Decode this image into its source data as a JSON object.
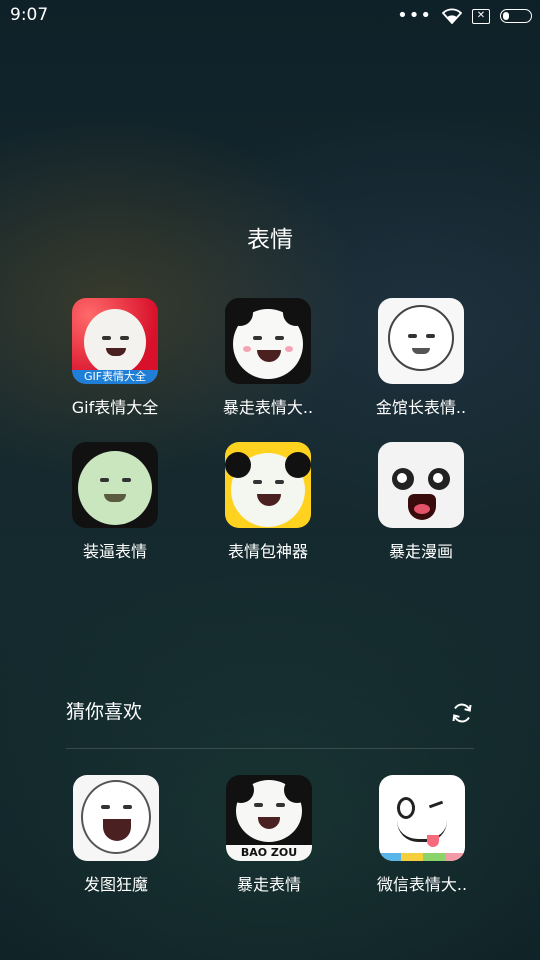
{
  "status_bar": {
    "time": "9:07",
    "icons": [
      "more-dots-icon",
      "wifi-icon",
      "no-sim-icon",
      "battery-icon"
    ]
  },
  "folder": {
    "title": "表情",
    "apps": [
      {
        "label": "Gif表情大全",
        "icon": "gif-meme-app-icon",
        "icon_text": "GIF表情大全"
      },
      {
        "label": "暴走表情大..",
        "icon": "baozou-meme-app-icon"
      },
      {
        "label": "金馆长表情..",
        "icon": "jinguanzhang-meme-app-icon"
      },
      {
        "label": "装逼表情",
        "icon": "zhuangbi-meme-app-icon"
      },
      {
        "label": "表情包神器",
        "icon": "meme-maker-app-icon"
      },
      {
        "label": "暴走漫画",
        "icon": "baozou-comic-app-icon"
      }
    ]
  },
  "recommend": {
    "title": "猜你喜欢",
    "apps": [
      {
        "label": "发图狂魔",
        "icon": "fatu-kuangmo-app-icon"
      },
      {
        "label": "暴走表情",
        "icon": "baozou-emoji-app-icon",
        "icon_text": "BAO ZOU"
      },
      {
        "label": "微信表情大..",
        "icon": "wechat-meme-app-icon"
      }
    ]
  }
}
